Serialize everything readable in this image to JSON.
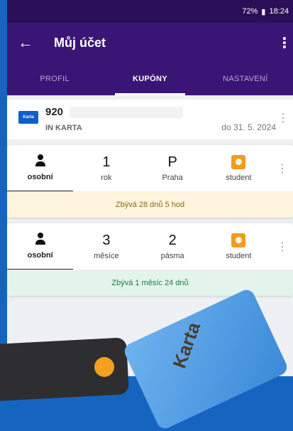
{
  "status": {
    "signal": "72%",
    "time": "18:24"
  },
  "appbar": {
    "back": "←",
    "title": "Můj účet",
    "menu": "⋮"
  },
  "tabs": [
    {
      "label": "PROFIL"
    },
    {
      "label": "KUPÓNY"
    },
    {
      "label": "NASTAVENÍ"
    }
  ],
  "card": {
    "logo_text": "Karta",
    "number": "920",
    "name": "IN KARTA",
    "valid": "do 31. 5. 2024"
  },
  "coupon1": {
    "cells": [
      {
        "label": "osobní"
      },
      {
        "value": "1",
        "label": "rok"
      },
      {
        "value": "P",
        "label": "Praha"
      },
      {
        "label": "student"
      }
    ],
    "remaining": "Zbývá 28 dnů 5 hod",
    "remaining_bg": "#fff4dd"
  },
  "coupon2": {
    "cells": [
      {
        "label": "osobní"
      },
      {
        "value": "3",
        "label": "měsíce"
      },
      {
        "value": "2",
        "label": "pásma"
      },
      {
        "label": "student"
      }
    ],
    "remaining": "Zbývá 1 měsíc 24 dnů",
    "remaining_bg": "#e3f4ea"
  },
  "card_image": {
    "text": "Karta"
  }
}
